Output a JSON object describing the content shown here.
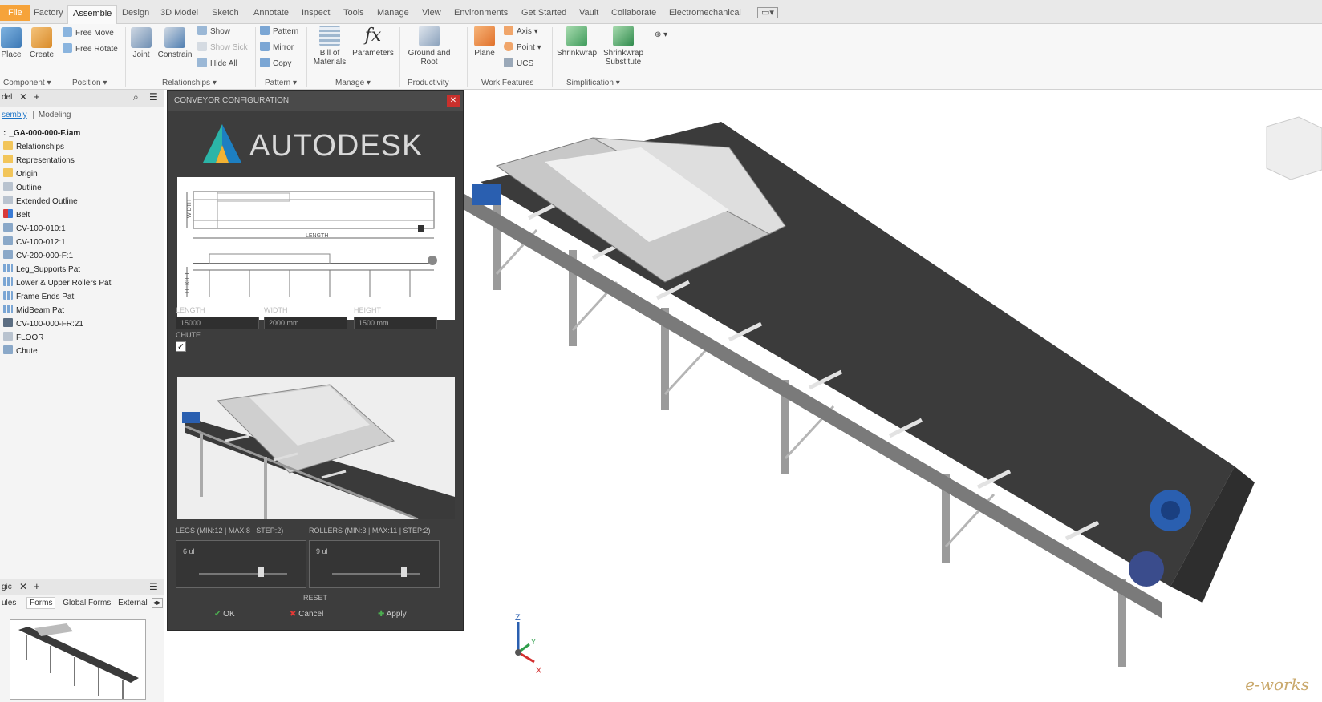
{
  "tabs": [
    "File",
    "Factory",
    "Assemble",
    "Design",
    "3D Model",
    "Sketch",
    "Annotate",
    "Inspect",
    "Tools",
    "Manage",
    "View",
    "Environments",
    "Get Started",
    "Vault",
    "Collaborate",
    "Electromechanical"
  ],
  "active_tab": "Assemble",
  "ribbon": {
    "place": "Place",
    "create": "Create",
    "free_move": "Free Move",
    "free_rotate": "Free Rotate",
    "joint": "Joint",
    "constrain": "Constrain",
    "show": "Show",
    "show_sick": "Show Sick",
    "hide_all": "Hide All",
    "pattern": "Pattern",
    "mirror": "Mirror",
    "copy": "Copy",
    "bill_of_materials": "Bill of Materials",
    "parameters": "Parameters",
    "ground_and_root": "Ground and Root",
    "plane": "Plane",
    "axis": "Axis",
    "point": "Point",
    "ucs": "UCS",
    "shrinkwrap": "Shrinkwrap",
    "shrinkwrap_substitute": "Shrinkwrap Substitute",
    "groups": {
      "component": "Component",
      "position": "Position",
      "relationships": "Relationships",
      "pattern": "Pattern",
      "manage": "Manage",
      "productivity": "Productivity",
      "work_features": "Work Features",
      "simplification": "Simplification"
    }
  },
  "browser": {
    "tab_label": "del",
    "subtab_assembly": "sembly",
    "subtab_modeling": "Modeling",
    "root": "_GA-000-000-F.iam",
    "items": [
      "Relationships",
      "Representations",
      "Origin",
      "Outline",
      "Extended Outline",
      "Belt",
      "CV-100-010:1",
      "CV-100-012:1",
      "CV-200-000-F:1",
      "Leg_Supports Pat",
      "Lower & Upper Rollers Pat",
      "Frame Ends Pat",
      "MidBeam Pat",
      "CV-100-000-FR:21",
      "FLOOR",
      "Chute"
    ]
  },
  "lower_panel": {
    "tab_label": "gic",
    "subtabs": [
      "ules",
      "Forms",
      "Global Forms",
      "External"
    ]
  },
  "dialog": {
    "title": "CONVEYOR CONFIGURATION",
    "logo_text": "AUTODESK",
    "drawing_width_label": "WIDTH",
    "drawing_length_label": "LENGTH",
    "drawing_height_label": "HEIGHT",
    "length_label": "LENGTH",
    "width_label": "WIDTH",
    "height_label": "HEIGHT",
    "length_value": "15000",
    "width_value": "2000 mm",
    "height_value": "1500 mm",
    "chute_label": "CHUTE",
    "chute_checked": true,
    "legs_label": "LEGS (MIN:12 | MAX:8 | STEP:2)",
    "rollers_label": "ROLLERS (MIN:3 | MAX:11 | STEP:2)",
    "legs_value": "6 ul",
    "rollers_value": "9 ul",
    "reset": "RESET",
    "ok": "OK",
    "cancel": "Cancel",
    "apply": "Apply"
  },
  "viewport": {
    "watermark": "e-works"
  },
  "colors": {
    "file_tab": "#f6a33a",
    "dialog_bg": "#3d3d3d",
    "close_red": "#c9302c",
    "belt_dark": "#3a3a3a",
    "motor_blue": "#2a5fb0"
  }
}
